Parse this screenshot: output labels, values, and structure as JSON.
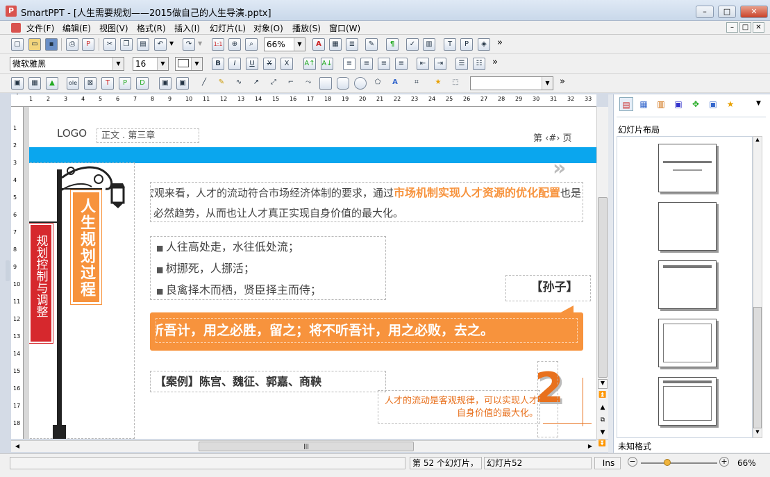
{
  "window": {
    "app_icon": "P",
    "title": "SmartPPT - [人生需要规划——2015做自己的人生导演.pptx]",
    "min": "–",
    "max": "□",
    "close": "✕"
  },
  "menu": [
    "文件(F)",
    "编辑(E)",
    "视图(V)",
    "格式(R)",
    "插入(I)",
    "幻灯片(L)",
    "对象(O)",
    "播放(S)",
    "窗口(W)"
  ],
  "toolbar": {
    "zoom": "66%",
    "font": "微软雅黑",
    "size": "16",
    "more": "»"
  },
  "ruler": {
    "h": [
      "1",
      "2",
      "3",
      "4",
      "5",
      "6",
      "7",
      "8",
      "9",
      "10",
      "11",
      "12",
      "13",
      "14",
      "15",
      "16",
      "17",
      "18",
      "19",
      "20",
      "21",
      "22",
      "23",
      "24",
      "25",
      "26",
      "27",
      "28",
      "29",
      "30",
      "31",
      "32",
      "33"
    ],
    "v": [
      "1",
      "2",
      "3",
      "4",
      "5",
      "6",
      "7",
      "8",
      "9",
      "10",
      "11",
      "12",
      "13",
      "14",
      "15",
      "16",
      "17",
      "18"
    ]
  },
  "slide": {
    "logo": "LOGO",
    "chapter": "正文 . 第三章",
    "page": "第 ‹#› 页",
    "sign_main": "人生规划过程",
    "sign_small": "规划控制与调整",
    "para_prefix": "宏观来看，人才的流动符合市场经济体制的要求，通过",
    "para_highlight": "市场机制实现人才资源的优化配置",
    "para_suffix": "也是必然趋势，从而也让人才真正实现自身价值的最大化。",
    "bullets": [
      "人往高处走，水往低处流；",
      "树挪死，人挪活；",
      "良禽择木而栖，贤臣择主而侍；"
    ],
    "quote_author": "【孙子】",
    "banner": "听吾计，用之必胜，留之；将不听吾计，用之必败，去之。",
    "case": "【案例】陈宫、魏征、郭嘉、商鞅",
    "note": "人才的流动是客观规律，可以实现人才自身价值的最大化。",
    "big_number": "2"
  },
  "panel": {
    "title": "幻灯片布局",
    "footer": "未知格式"
  },
  "status": {
    "slides": "第 52 个幻灯片，",
    "slide_name": "幻灯片52",
    "mode": "Ins",
    "zoom": "66%"
  },
  "colors": {
    "orange": "#f7933d",
    "blue": "#0aa6ee",
    "red": "#d6282d",
    "dark_orange": "#e8711e"
  }
}
